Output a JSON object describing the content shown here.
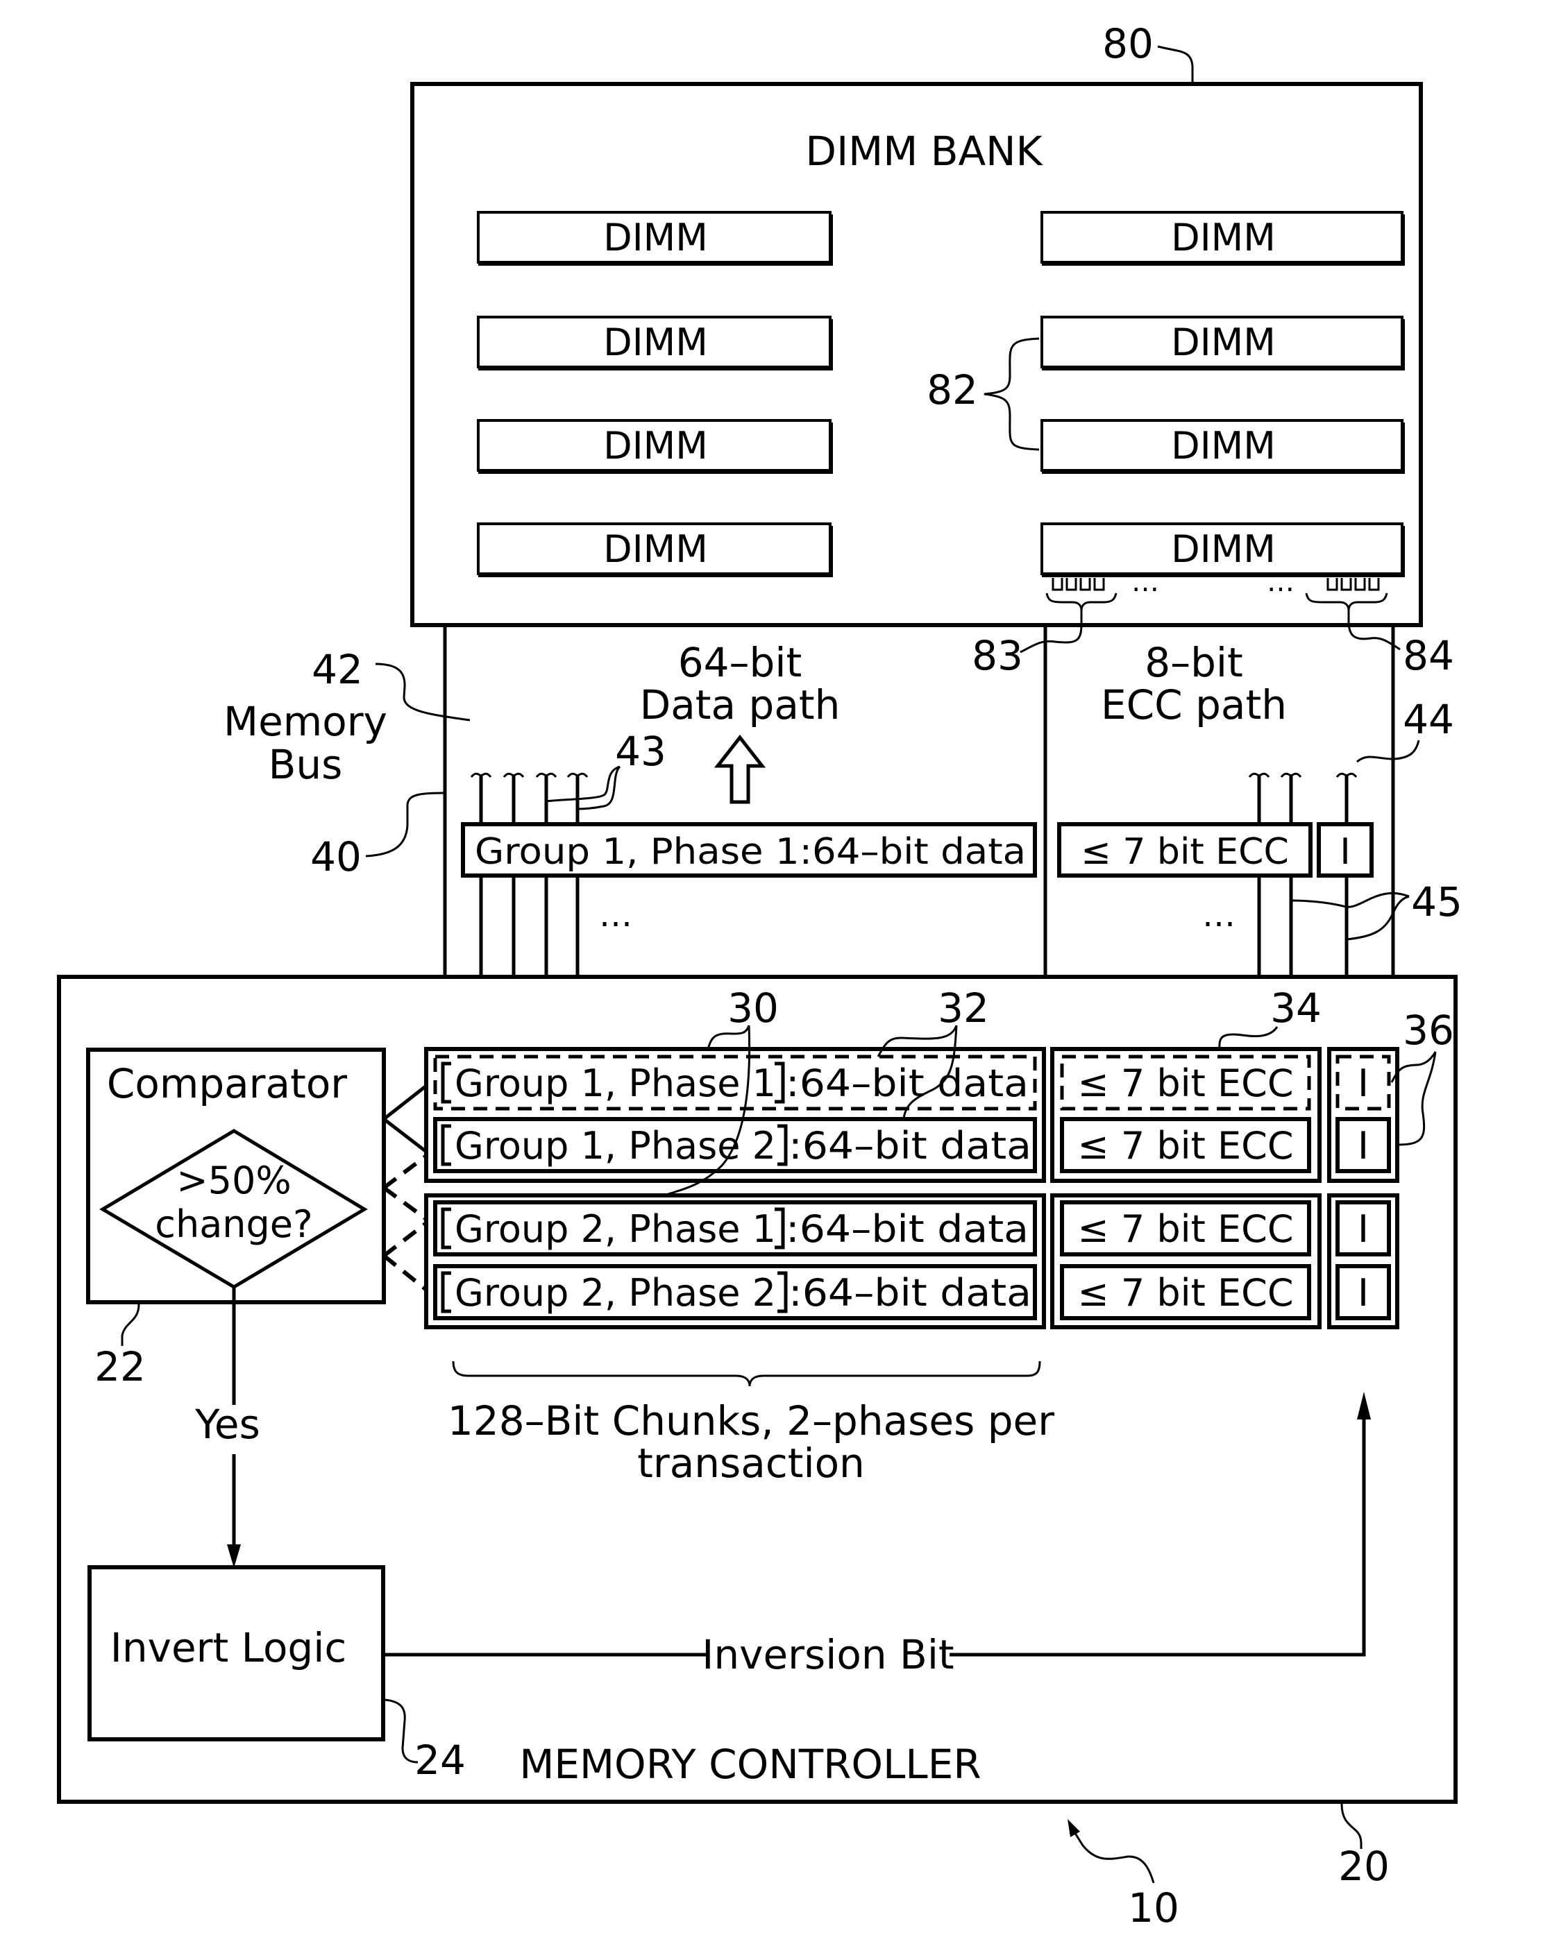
{
  "figure": {
    "dimm_bank": {
      "title": "DIMM BANK",
      "ref": "80",
      "dimm_label": "DIMM",
      "dimm_count_per_column": 4,
      "dimm_group_ref": "82",
      "data_pins_ref": "83",
      "ecc_pins_ref": "84",
      "pin_ellipsis": "…"
    },
    "memory_bus": {
      "label_line1": "Memory",
      "label_line2": "Bus",
      "bus_ref": "42",
      "bus_outline_ref": "40",
      "data_lines_ref": "43",
      "ecc_lines_ref": "44",
      "lines_ref": "45",
      "data_path_line1": "64–bit",
      "data_path_line2": "Data path",
      "ecc_path_line1": "8–bit",
      "ecc_path_line2": "ECC path",
      "data_segment": "Group 1, Phase 1:64–bit data",
      "ecc_segment": "≤ 7 bit ECC",
      "inversion_segment": "I",
      "ellipsis": "…"
    },
    "memory_controller": {
      "title": "MEMORY CONTROLLER",
      "ref": "20",
      "system_ref": "10",
      "comparator": {
        "title": "Comparator",
        "decision_line1": ">50%",
        "decision_line2": "change?",
        "ref": "22",
        "yes_label": "Yes"
      },
      "invert_logic": {
        "title": "Invert Logic",
        "ref": "24",
        "output_label": "Inversion Bit"
      },
      "chunk_refs": {
        "data": "30",
        "data_field": "32",
        "ecc": "34",
        "inversion": "36"
      },
      "rows": [
        {
          "group": "Group 1, Phase 1",
          "data": ":64–bit data",
          "ecc": "≤ 7 bit ECC",
          "inv": "I",
          "highlight": true
        },
        {
          "group": "Group 1, Phase 2",
          "data": ":64–bit data",
          "ecc": "≤ 7 bit ECC",
          "inv": "I",
          "highlight": false
        },
        {
          "group": "Group 2, Phase 1",
          "data": ":64–bit data",
          "ecc": "≤ 7 bit ECC",
          "inv": "I",
          "highlight": false
        },
        {
          "group": "Group 2, Phase 2",
          "data": ":64–bit data",
          "ecc": "≤ 7 bit ECC",
          "inv": "I",
          "highlight": false
        }
      ],
      "chunk_caption_line1": "128–Bit Chunks, 2–phases per",
      "chunk_caption_line2": "transaction"
    }
  }
}
